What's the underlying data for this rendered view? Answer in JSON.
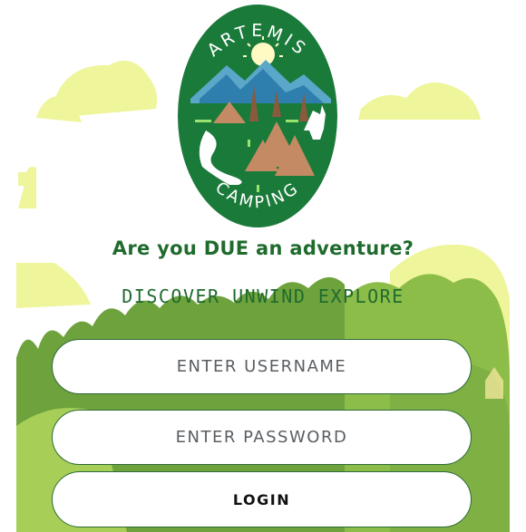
{
  "logo": {
    "top_text": "ARTEMIS",
    "bottom_text": "CAMPING"
  },
  "tagline": "Are you DUE an adventure?",
  "motto": "DISCOVER UNWIND EXPLORE",
  "form": {
    "username_placeholder": "ENTER USERNAME",
    "password_placeholder": "ENTER PASSWORD",
    "login_label": "LOGIN"
  },
  "colors": {
    "brand_green": "#1a7a3a",
    "text_green": "#1f6b2e",
    "field_border": "#2d6a36",
    "pale_yellow": "#eff59a",
    "foliage_dark": "#6ea23c",
    "foliage_light": "#9bc94f"
  }
}
